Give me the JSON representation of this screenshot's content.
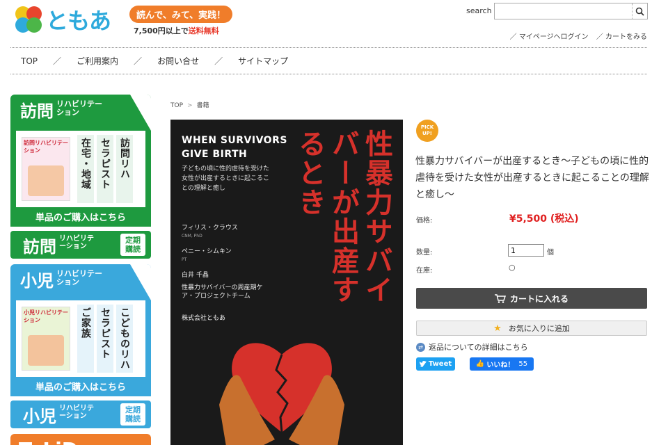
{
  "header": {
    "logo_text": "ともあ",
    "promo_pill": "読んで、みて、実践！",
    "promo_amount": "7,500円以上で",
    "promo_free": "送料無料",
    "search_label": "search",
    "search_value": "",
    "account_links": [
      "／ マイページへログイン",
      "／ カートをみる"
    ]
  },
  "nav": {
    "items": [
      "TOP",
      "ご利用案内",
      "お問い合せ",
      "サイトマップ"
    ],
    "separator": "／"
  },
  "sidebar": {
    "banner1": {
      "head_big": "訪問",
      "head_small": "リハビリテーション",
      "cover_title": "訪問リハビリテーション",
      "columns": [
        "訪問リハ",
        "セラピスト",
        "在宅・地域"
      ],
      "foot": "単品のご購入はこちら"
    },
    "small1": {
      "name_big": "訪問",
      "name_small": "リハビリテーション",
      "tag": "定期購読"
    },
    "banner2": {
      "head_big": "小児",
      "head_small": "リハビリテーション",
      "cover_title": "小児リハビリテーション",
      "columns": [
        "こどものリハ",
        "セラピスト",
        "ご家族"
      ],
      "foot": "単品のご購入はこちら"
    },
    "small2": {
      "name_big": "小児",
      "name_small": "リハビリテーション",
      "tag": "定期購読"
    },
    "telide": "TeLiDe"
  },
  "breadcrumb": {
    "items": [
      "TOP",
      "書籍"
    ],
    "separator": ">"
  },
  "book": {
    "en_title": "WHEN SURVIVORS GIVE BIRTH",
    "subtitle": "子どもの頃に性的虐待を受けた女性が出産するときに起こることの理解と癒し",
    "jp_title": "性暴力サバイバーが出産するとき",
    "author1": "フィリス・クラウス",
    "author1_note": "CNM, PhD",
    "author2": "ペニー・シムキン",
    "author2_note": "PT",
    "translator": "白井 千晶",
    "team": "性暴力サバイバーの周産期ケア・プロジェクトチーム",
    "publisher": "株式会社ともあ"
  },
  "product": {
    "pickup_badge": "PICK UP!",
    "title": "性暴力サバイバーが出産するとき～子どもの頃に性的虐待を受けた女性が出産するときに起こることの理解と癒し～",
    "price_label": "価格:",
    "price": "¥5,500 (税込)",
    "qty_label": "数量:",
    "qty_value": "1",
    "qty_unit": "個",
    "stock_label": "在庫:",
    "stock_value": "○",
    "cart_button": "カートに入れる",
    "fav_button": "お気に入りに追加",
    "return_link": "返品についての詳細はこちら",
    "tweet": "Tweet",
    "like": "いいね！",
    "like_count": "55"
  },
  "colors": {
    "green": "#1e9a3f",
    "blue": "#3aa8dc",
    "orange": "#f07d2a",
    "price_red": "#e02020",
    "book_red": "#d6312b"
  }
}
